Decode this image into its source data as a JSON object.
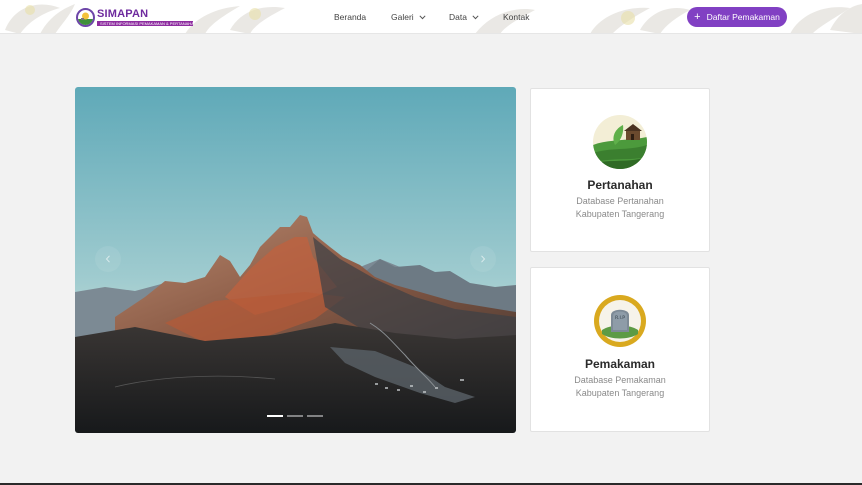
{
  "header": {
    "logo_name": "SIMAPAN",
    "logo_tagline": "SISTEM INFORMASI PEMAKAMAN & PERTANAHAN",
    "nav": [
      {
        "label": "Beranda",
        "has_dropdown": false
      },
      {
        "label": "Galeri",
        "has_dropdown": true
      },
      {
        "label": "Data",
        "has_dropdown": true
      },
      {
        "label": "Kontak",
        "has_dropdown": false
      }
    ],
    "cta_label": "Daftar Pemakaman",
    "cta_icon": "plus-icon"
  },
  "carousel": {
    "image": "mountain-landscape",
    "prev_icon": "chevron-left-icon",
    "next_icon": "chevron-right-icon",
    "slide_count": 3,
    "active_index": 0
  },
  "cards": [
    {
      "title": "Pertanahan",
      "desc_line1": "Database Pertanahan",
      "desc_line2": "Kabupaten Tangerang",
      "icon": "farmland-icon"
    },
    {
      "title": "Pemakaman",
      "desc_line1": "Database Pemakaman",
      "desc_line2": "Kabupaten Tangerang",
      "icon": "tombstone-icon"
    }
  ],
  "colors": {
    "accent": "#8140c3",
    "logo_purple": "#6e2a9e",
    "background": "#f2f2f2"
  }
}
